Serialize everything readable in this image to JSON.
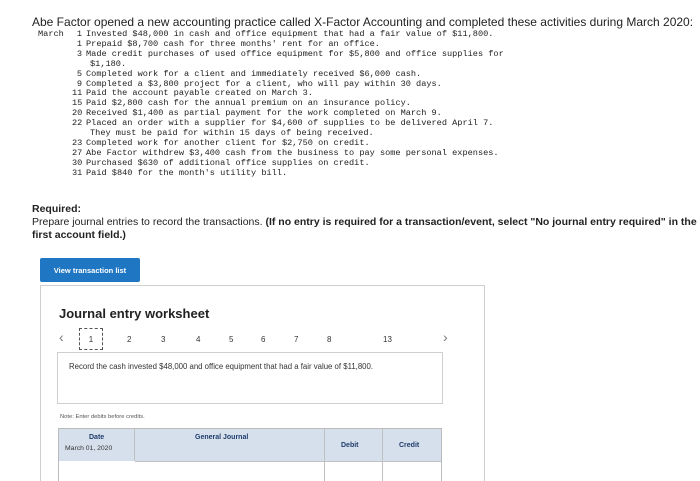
{
  "intro": "Abe Factor opened a new accounting practice called X-Factor Accounting and completed these activities during March 2020:",
  "transactions": {
    "month": "March",
    "items": [
      {
        "day": "1",
        "text": "Invested $48,000 in cash and office equipment that had a fair value of $11,800."
      },
      {
        "day": "1",
        "text": "Prepaid $8,700 cash for three months' rent for an office."
      },
      {
        "day": "3",
        "text": "Made credit purchases of used office equipment for $5,800 and office supplies for",
        "cont": "$1,180."
      },
      {
        "day": "5",
        "text": "Completed work for a client and immediately received $6,000 cash."
      },
      {
        "day": "9",
        "text": "Completed a $3,800 project for a client, who will pay within 30 days."
      },
      {
        "day": "11",
        "text": "Paid the account payable created on March 3."
      },
      {
        "day": "15",
        "text": "Paid $2,800 cash for the annual premium on an insurance policy."
      },
      {
        "day": "20",
        "text": "Received $1,400 as partial payment for the work completed on March 9."
      },
      {
        "day": "22",
        "text": "Placed an order with a supplier for $4,600 of supplies to be delivered April 7.",
        "cont": "They must be paid for within 15 days of being received."
      },
      {
        "day": "23",
        "text": "Completed work for another client for $2,750 on credit."
      },
      {
        "day": "27",
        "text": "Abe Factor withdrew $3,400 cash from the business to pay some personal expenses."
      },
      {
        "day": "30",
        "text": "Purchased $630 of additional office supplies on credit."
      },
      {
        "day": "31",
        "text": "Paid $840 for the month's utility bill."
      }
    ]
  },
  "required": {
    "label": "Required:",
    "instruction": "Prepare journal entries to record the transactions.",
    "note": "(If no entry is required for a transaction/event, select \"No journal entry required\" in the first account field.)"
  },
  "view_button": "View transaction list",
  "worksheet": {
    "title": "Journal entry worksheet",
    "pages": [
      "1",
      "2",
      "3",
      "4",
      "5",
      "6",
      "7",
      "8",
      "13"
    ],
    "active_page": "1",
    "description": "Record the cash invested $48,000 and office equipment that had a fair value of $11,800.",
    "note": "Note: Enter debits before credits.",
    "table": {
      "headers": {
        "date": "Date",
        "account": "General Journal",
        "debit": "Debit",
        "credit": "Credit"
      },
      "row": {
        "date": "March 01, 2020"
      }
    }
  },
  "icons": {
    "prev": "chevron-left-icon",
    "next": "chevron-right-icon"
  },
  "colors": {
    "button": "#1f76c3",
    "table_header": "#d6e0ec",
    "header_text": "#1e3c6b"
  }
}
